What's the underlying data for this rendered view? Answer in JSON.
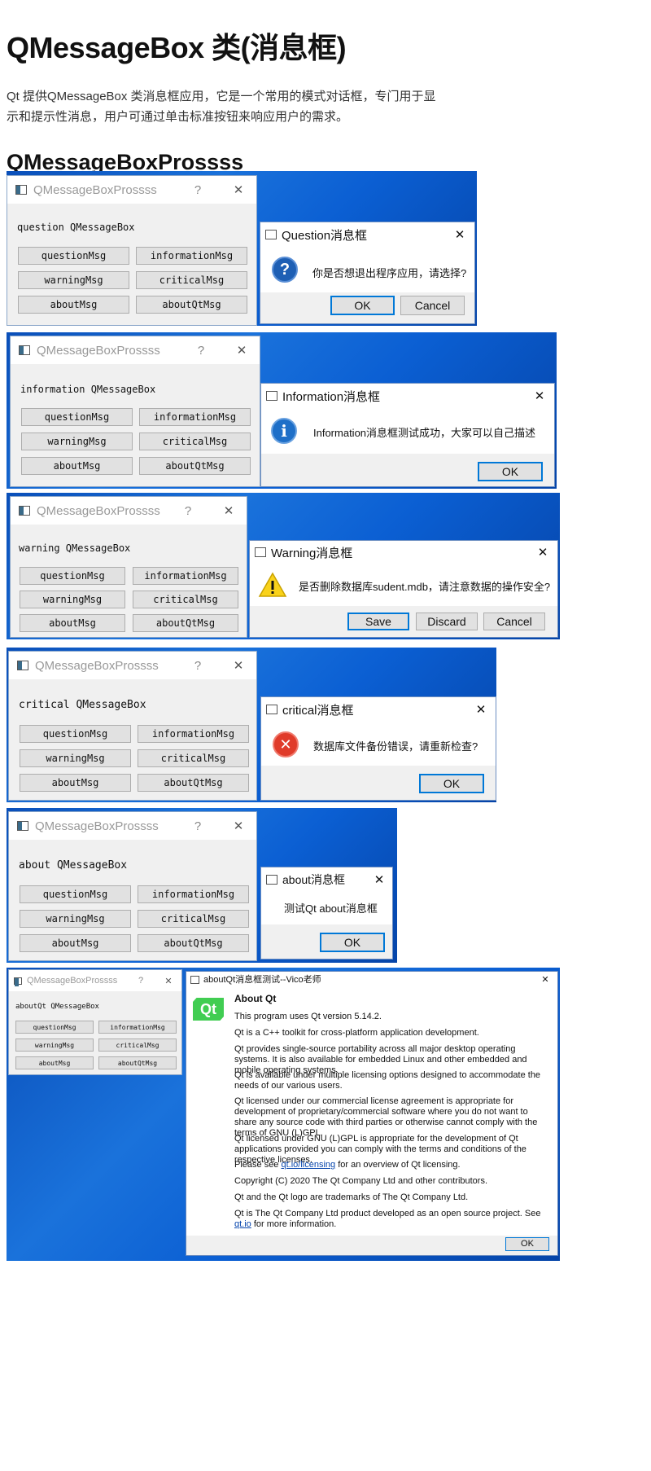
{
  "heading": "QMessageBox 类(消息框)",
  "intro": "Qt 提供QMessageBox 类消息框应用，它是一个常用的模式对话框，专门用于显示和提示性消息，用户可通过单击标准按钮来响应用户的需求。",
  "subheading": "QMessageBoxProssss",
  "main_window": {
    "title": "QMessageBoxProssss",
    "help": "?",
    "close": "✕",
    "buttons": [
      "questionMsg",
      "informationMsg",
      "warningMsg",
      "criticalMsg",
      "aboutMsg",
      "aboutQtMsg"
    ]
  },
  "panels": [
    {
      "label": "question QMessageBox",
      "dialog_title": "Question消息框",
      "icon": "question-icon",
      "message": "你是否想退出程序应用，请选择?",
      "buttons": [
        "OK",
        "Cancel"
      ]
    },
    {
      "label": "information QMessageBox",
      "dialog_title": "Information消息框",
      "icon": "information-icon",
      "message": "Information消息框测试成功，大家可以自己描述",
      "buttons": [
        "OK"
      ]
    },
    {
      "label": "warning QMessageBox",
      "dialog_title": "Warning消息框",
      "icon": "warning-icon",
      "message": "是否删除数据库sudent.mdb，请注意数据的操作安全?",
      "buttons": [
        "Save",
        "Discard",
        "Cancel"
      ]
    },
    {
      "label": "critical QMessageBox",
      "dialog_title": "critical消息框",
      "icon": "critical-icon",
      "message": "数据库文件备份错误，请重新检查?",
      "buttons": [
        "OK"
      ]
    },
    {
      "label": "about QMessageBox",
      "dialog_title": "about消息框",
      "icon": "",
      "message": "测试Qt about消息框",
      "buttons": [
        "OK"
      ]
    },
    {
      "label": "aboutQt QMessageBox",
      "dialog_title": "aboutQt消息框测试--Vico老师",
      "icon": "qt-logo",
      "message": "",
      "buttons": [
        "OK"
      ]
    }
  ],
  "about_qt": {
    "logo_text": "Qt",
    "heading": "About Qt",
    "version_line": "This program uses Qt version 5.14.2.",
    "p1": "Qt is a C++ toolkit for cross-platform application development.",
    "p2": "Qt provides single-source portability across all major desktop operating systems. It is also available for embedded Linux and other embedded and mobile operating systems.",
    "p3": "Qt is available under multiple licensing options designed to accommodate the needs of our various users.",
    "p4": "Qt licensed under our commercial license agreement is appropriate for development of proprietary/commercial software where you do not want to share any source code with third parties or otherwise cannot comply with the terms of GNU (L)GPL.",
    "p5": "Qt licensed under GNU (L)GPL is appropriate for the development of Qt applications provided you can comply with the terms and conditions of the respective licenses.",
    "p6_pre": "Please see ",
    "p6_link": "qt.io/licensing",
    "p6_post": " for an overview of Qt licensing.",
    "p7": "Copyright (C) 2020 The Qt Company Ltd and other contributors.",
    "p8": "Qt and the Qt logo are trademarks of The Qt Company Ltd.",
    "p9_pre": "Qt is The Qt Company Ltd product developed as an open source project. See ",
    "p9_link": "qt.io",
    "p9_post": " for more information.",
    "ok": "OK"
  },
  "colors": {
    "desktop_blue": "#0b5fd3",
    "default_button_border": "#0078d7",
    "critical_red": "#e03b2a",
    "qt_green": "#41cd52"
  }
}
